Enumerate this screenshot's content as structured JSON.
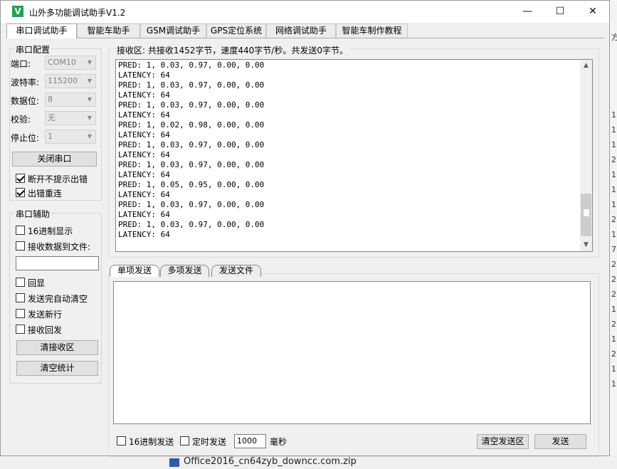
{
  "window": {
    "app_icon": "V",
    "title": "山外多功能调试助手V1.2",
    "minimize_glyph": "—",
    "maximize_glyph": "☐",
    "close_glyph": "✕"
  },
  "tabs": [
    "串口调试助手",
    "智能车助手",
    "GSM调试助手",
    "GPS定位系统",
    "网络调试助手",
    "智能车制作教程"
  ],
  "serial_config": {
    "group_title": "串口配置",
    "port_label": "端口:",
    "port_value": "COM10",
    "baud_label": "波特率:",
    "baud_value": "115200",
    "databits_label": "数据位:",
    "databits_value": "8",
    "parity_label": "校验:",
    "parity_value": "无",
    "stopbits_label": "停止位:",
    "stopbits_value": "1",
    "close_port_button": "关闭串口",
    "no_prompt_label": "断开不提示出错",
    "reconnect_label": "出错重连"
  },
  "serial_aux": {
    "group_title": "串口辅助",
    "hex_display": "16进制显示",
    "save_to_file": "接收数据到文件:",
    "file_path": "",
    "echo": "回显",
    "auto_clear": "发送完自动清空",
    "send_newline": "发送新行",
    "recv_reply": "接收回发",
    "clear_recv_button": "清接收区",
    "clear_stats_button": "清空统计"
  },
  "receive": {
    "status": "接收区: 共接收1452字节，速度440字节/秒。共发送0字节。",
    "lines": [
      "PRED: 1, 0.03, 0.97, 0.00, 0.00",
      "LATENCY: 64",
      "PRED: 1, 0.03, 0.97, 0.00, 0.00",
      "LATENCY: 64",
      "PRED: 1, 0.03, 0.97, 0.00, 0.00",
      "LATENCY: 64",
      "PRED: 1, 0.02, 0.98, 0.00, 0.00",
      "LATENCY: 64",
      "PRED: 1, 0.03, 0.97, 0.00, 0.00",
      "LATENCY: 64",
      "PRED: 1, 0.03, 0.97, 0.00, 0.00",
      "LATENCY: 64",
      "PRED: 1, 0.05, 0.95, 0.00, 0.00",
      "LATENCY: 64",
      "PRED: 1, 0.03, 0.97, 0.00, 0.00",
      "LATENCY: 64",
      "PRED: 1, 0.03, 0.97, 0.00, 0.00",
      "LATENCY: 64"
    ]
  },
  "send": {
    "tabs": [
      "单项发送",
      "多项发送",
      "发送文件"
    ],
    "content": "",
    "hex_send": "16进制发送",
    "timed_send": "定时发送",
    "interval": "1000",
    "interval_unit": "毫秒",
    "clear_send_button": "清空发送区",
    "send_button": "发送"
  },
  "background": {
    "right_edge_digits": [
      "1",
      "1",
      "1",
      "2",
      "1",
      "1",
      "1",
      "2",
      "1",
      "7",
      "2",
      "2",
      "2",
      "1",
      "2",
      "1",
      "2",
      "1",
      "1"
    ],
    "right_top_fragment": "方",
    "left_fragment": "内",
    "bottom_file": "Office2016_cn64zyb_downcc.com.zip"
  }
}
